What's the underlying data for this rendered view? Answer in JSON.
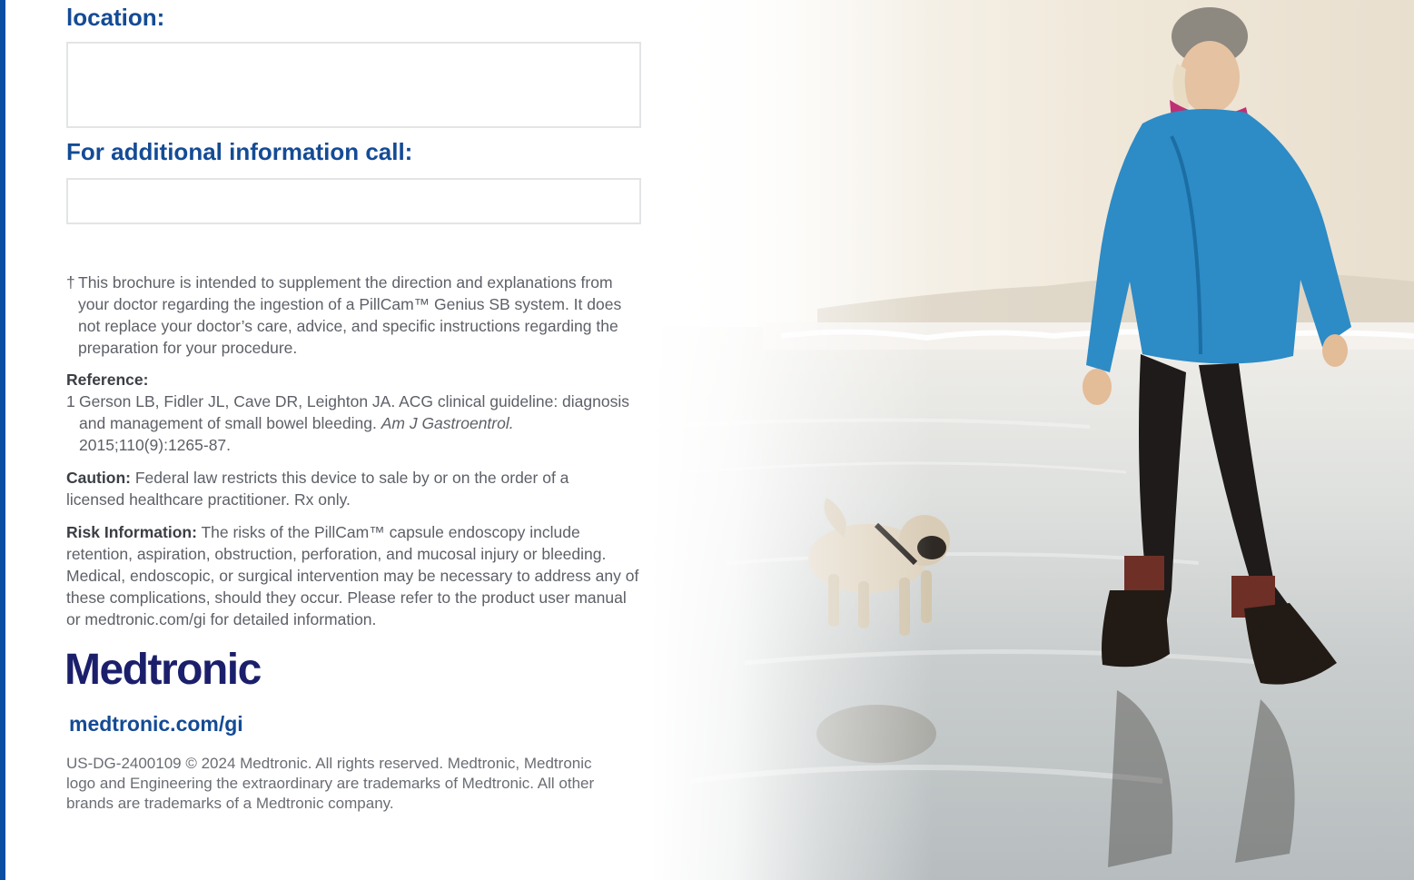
{
  "form": {
    "location_label": "location:",
    "location_value": "",
    "call_label": "For additional information call:",
    "call_value": ""
  },
  "disclaimer": {
    "mark": "†",
    "text": "This brochure is intended to supplement the direction and explanations from your doctor regarding the ingestion of a PillCam™ Genius SB system. It does not replace your doctor’s care, advice, and specific instructions regarding the preparation for your procedure."
  },
  "reference": {
    "heading": "Reference:",
    "number": "1",
    "text_before": "Gerson LB, Fidler JL, Cave DR, Leighton JA. ACG clinical guideline: diagnosis and management of small bowel bleeding. ",
    "journal": "Am J Gastroentrol.",
    "text_after": " 2015;110(9):1265-87."
  },
  "caution": {
    "label": "Caution:",
    "text": " Federal law restricts this device to sale by or on the order of a licensed healthcare practitioner. Rx only."
  },
  "risk": {
    "label": "Risk Information:",
    "text": " The risks of the PillCam™ capsule endoscopy include retention, aspiration, obstruction, perforation, and mucosal injury or bleeding. Medical, endoscopic, or surgical intervention may be necessary to address any of these complications, should they occur. Please refer to the product user manual or medtronic.com/gi for detailed information."
  },
  "brand": {
    "logo_text": "Medtronic",
    "website": "medtronic.com/gi",
    "copyright": "US-DG-2400109 © 2024 Medtronic. All rights reserved. Medtronic, Medtronic logo and Engineering the extraordinary are trademarks of Medtronic. All other brands are trademarks of a Medtronic company."
  },
  "colors": {
    "brand_blue": "#144b95",
    "logo_navy": "#1b1f6b",
    "accent_rule": "#0a4ea3"
  },
  "icons": {
    "photo": "beach-walk-photo"
  }
}
